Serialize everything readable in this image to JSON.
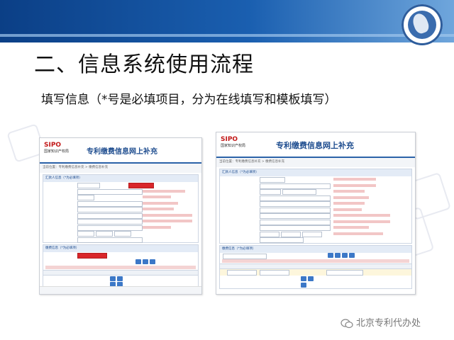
{
  "slide": {
    "title": "二、信息系统使用流程",
    "subtitle": "填写信息（*号是必填项目，分为在线填写和模板填写）",
    "footer": "北京专利代办处",
    "footer_icon": "wechat-icon"
  },
  "colors": {
    "header_blue": "#0b3f86",
    "accent_red": "#c21818",
    "button_blue": "#3c78c7"
  },
  "shots": {
    "left": {
      "logo": "SIPO",
      "logo_sub": "国家知识产权局",
      "app_title": "专利缴费信息网上补充",
      "breadcrumb": "当前位置：专利缴费信息补充 > 缴费信息补充",
      "payer_section": "汇款人信息（*为必填项）",
      "fee_section": "缴费信息（*为必填项）",
      "buttons": [
        "提交",
        "取消",
        "保存"
      ]
    },
    "right": {
      "logo": "SIPO",
      "logo_sub": "国家知识产权局",
      "app_title": "专利缴费信息网上补充",
      "breadcrumb": "当前位置：专利缴费信息补充 > 缴费信息补充",
      "payer_section": "汇款人信息（*为必填项）",
      "fee_section": "缴费信息（*为必填项）",
      "buttons": [
        "提交",
        "取消",
        "保存"
      ]
    }
  }
}
